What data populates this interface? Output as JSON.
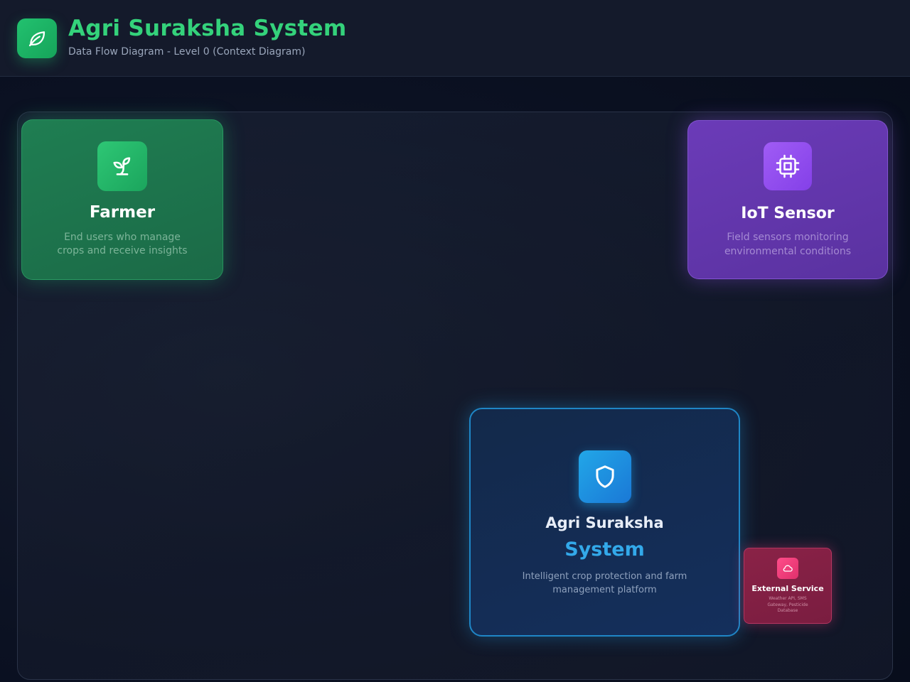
{
  "header": {
    "logo_icon": "leaf-icon",
    "title": "Agri Suraksha System",
    "subtitle": "Data Flow Diagram - Level 0 (Context Diagram)"
  },
  "colors": {
    "title": "#34d27b",
    "farmer": "#1f7e52",
    "iot": "#6b3bb8",
    "system_border": "#1f86c6",
    "system_accent": "#33a9ea",
    "external": "#8a2247"
  },
  "entities": {
    "farmer": {
      "icon": "sprout-icon",
      "name": "Farmer",
      "desc_line1": "End users who manage",
      "desc_line2": "crops and receive insights"
    },
    "iot": {
      "icon": "chip-icon",
      "name": "IoT Sensor",
      "desc_line1": "Field sensors monitoring",
      "desc_line2": "environmental conditions"
    },
    "system": {
      "icon": "shield-icon",
      "name_line1": "Agri Suraksha",
      "name_line2": "System",
      "desc_line1": "Intelligent crop protection and farm",
      "desc_line2": "management platform"
    },
    "external": {
      "icon": "cloud-icon",
      "name": "External Service",
      "desc_line1": "Weather API, SMS",
      "desc_line2": "Gateway, Pesticide",
      "desc_line3": "Database"
    }
  }
}
